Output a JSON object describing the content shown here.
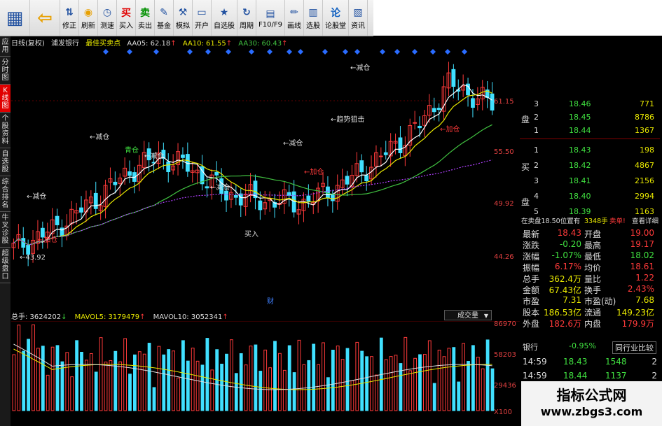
{
  "toolbar": {
    "buttons": [
      {
        "label": "",
        "icon": "grid-icon"
      },
      {
        "label": "",
        "icon": "back-arrow-icon"
      },
      {
        "label": "修正",
        "icon": "updown-icon"
      },
      {
        "label": "刷新",
        "icon": "coin-icon"
      },
      {
        "label": "测速",
        "icon": "clock-icon"
      },
      {
        "label": "买入",
        "icon": "buy-icon",
        "glyph": "买"
      },
      {
        "label": "卖出",
        "icon": "sell-icon",
        "glyph": "卖"
      },
      {
        "label": "基金",
        "icon": "pen-icon"
      },
      {
        "label": "模拟",
        "icon": "hammer-icon"
      },
      {
        "label": "开户",
        "icon": "card-icon"
      },
      {
        "label": "自选股",
        "icon": "star-folder-icon"
      },
      {
        "label": "周期",
        "icon": "cycle-icon"
      },
      {
        "label": "F10/F9",
        "icon": "doc-icon"
      },
      {
        "label": "画线",
        "icon": "pencil-icon"
      },
      {
        "label": "选股",
        "icon": "filter-icon"
      },
      {
        "label": "论股堂",
        "icon": "talk-icon",
        "glyph": "论"
      },
      {
        "label": "资讯",
        "icon": "news-icon"
      }
    ]
  },
  "lefttabs": [
    "应用",
    "分时图",
    "K线图",
    "个股资料",
    "自选股",
    "综合排名",
    "牛叉诊股",
    "超级盘口"
  ],
  "chart": {
    "period": "日线(复权)",
    "stock": "浦发银行",
    "indicator": "最佳买卖点",
    "aa05": "AA05: 62.18",
    "aa10": "AA10: 61.55",
    "aa30": "AA30: 60.43",
    "y_labels": [
      "61.15",
      "55.50",
      "49.92",
      "44.26"
    ],
    "annotations": {
      "jiancang": "减仓",
      "jiacang": "加仓",
      "qushi": "趋势狙击",
      "maiin": "买入",
      "cai": "财",
      "low": "43.92"
    }
  },
  "volume": {
    "total": "总手: 3624202",
    "mavol5": "MAVOL5: 3179479",
    "mavol10": "MAVOL10: 3052341",
    "dropdown": "成交量",
    "y_labels": [
      "86970",
      "58203",
      "29436",
      "X100"
    ]
  },
  "orderbook": {
    "sell_label": "卖\n盘",
    "buy_label": "买\n盘",
    "sell": [
      {
        "lvl": "3",
        "price": "18.46",
        "vol": "771"
      },
      {
        "lvl": "2",
        "price": "18.45",
        "vol": "8786"
      },
      {
        "lvl": "1",
        "price": "18.44",
        "vol": "1367"
      }
    ],
    "buy": [
      {
        "lvl": "1",
        "price": "18.43",
        "vol": "198"
      },
      {
        "lvl": "2",
        "price": "18.42",
        "vol": "4867"
      },
      {
        "lvl": "3",
        "price": "18.41",
        "vol": "2156"
      },
      {
        "lvl": "4",
        "price": "18.40",
        "vol": "2994"
      },
      {
        "lvl": "5",
        "price": "18.39",
        "vol": "1163"
      }
    ],
    "info_a": "在卖盘18.50位置有",
    "info_b": "3348手",
    "info_c": "卖单!",
    "info_d": "查看详细"
  },
  "quote": [
    {
      "l": "最新",
      "lv": "18.43",
      "r": "开盘",
      "rv": "19.00"
    },
    {
      "l": "涨跌",
      "lv": "-0.20",
      "r": "最高",
      "rv": "19.17"
    },
    {
      "l": "涨幅",
      "lv": "-1.07%",
      "r": "最低",
      "rv": "18.02"
    },
    {
      "l": "振幅",
      "lv": "6.17%",
      "r": "均价",
      "rv": "18.61"
    },
    {
      "l": "总手",
      "lv": "362.4万",
      "r": "量比",
      "rv": "1.22"
    },
    {
      "l": "金额",
      "lv": "67.43亿",
      "r": "换手",
      "rv": "2.43%"
    },
    {
      "l": "市盈",
      "lv": "7.31",
      "r": "市盈(动)",
      "rv": "7.68"
    },
    {
      "l": "股本",
      "lv": "186.53亿",
      "r": "流通",
      "rv": "149.23亿"
    },
    {
      "l": "外盘",
      "lv": "182.6万",
      "r": "内盘",
      "rv": "179.9万"
    }
  ],
  "sector": {
    "name": "银行",
    "pct": "-0.95%",
    "btn": "同行业比较"
  },
  "ticks": [
    {
      "t": "14:59",
      "p": "18.43",
      "v": "1548",
      "n": "2"
    },
    {
      "t": "14:59",
      "p": "18.44",
      "v": "1137",
      "n": "2"
    }
  ],
  "watermark": {
    "line1": "指标公式网",
    "line2": "www.zbgs3.com"
  },
  "colors": {
    "up": "#ff3a3a",
    "down": "#40e0ff",
    "bg": "#000000",
    "ma_yellow": "#e8e800",
    "ma_purple": "#b040ff",
    "signal_blue": "#2a6cff"
  }
}
